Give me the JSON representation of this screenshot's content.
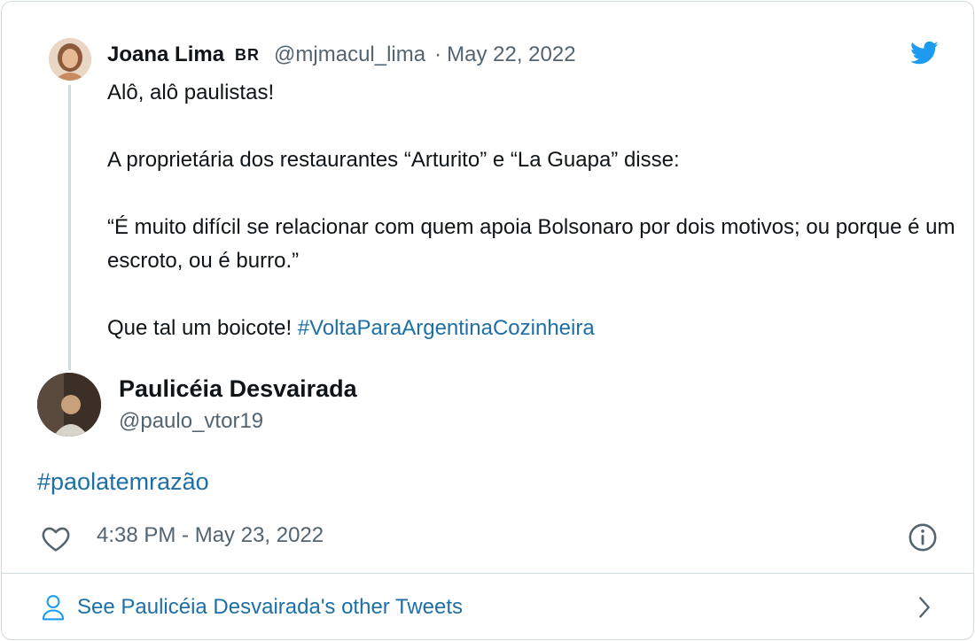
{
  "quoted_tweet": {
    "name": "Joana Lima",
    "badge": "BR",
    "handle": "@mjmacul_lima",
    "separator": "·",
    "date": "May 22, 2022",
    "lines": [
      "Alô, alô paulistas!",
      "A proprietária dos restaurantes “Arturito” e “La Guapa” disse:",
      "“É muito difícil se relacionar com quem apoia Bolsonaro por dois motivos; ou porque é um escroto, ou é burro.”",
      "Que tal um boicote!"
    ],
    "hashtag": "#VoltaParaArgentinaCozinheira",
    "avatar_icon": "profile-photo"
  },
  "reply": {
    "name": "Paulicéia Desvairada",
    "handle": "@paulo_vtor19",
    "text": "#paolatemrazão",
    "avatar_icon": "profile-photo"
  },
  "meta": {
    "timestamp": "4:38 PM - May 23, 2022",
    "like_icon": "heart-icon",
    "info_icon": "info-icon"
  },
  "footer": {
    "label": "See Paulicéia Desvairada's other Tweets",
    "person_icon": "person-icon",
    "chevron_icon": "chevron-right-icon"
  },
  "brand": {
    "logo_icon": "twitter-bird-icon",
    "accent_color": "#1d9bf0",
    "link_color": "#1d6fa5",
    "text_color": "#0f1419",
    "muted_color": "#536471",
    "border_color": "#cfd9de"
  }
}
